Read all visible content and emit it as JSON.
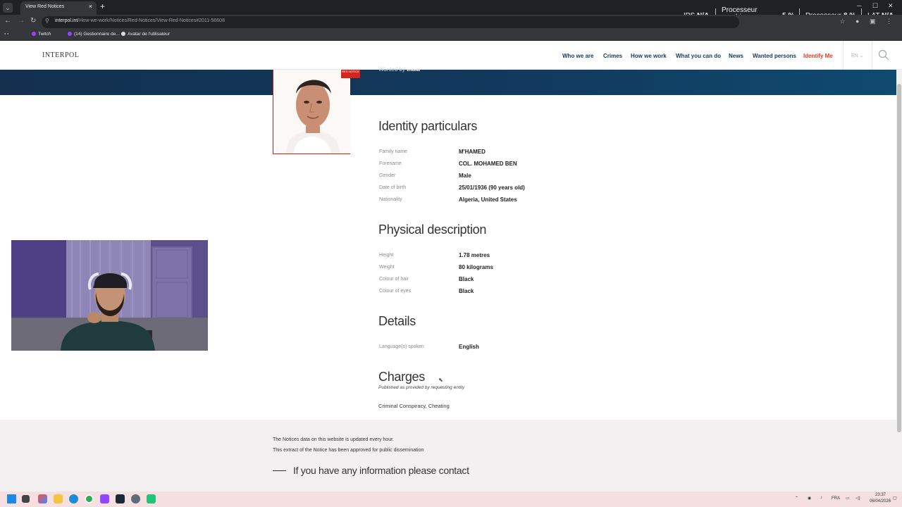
{
  "browser": {
    "tab_title": "View Red Notices",
    "tab_close": "×",
    "new_tab": "+",
    "tab_menu": "⌄",
    "url_domain": "interpol.int",
    "url_path": "/How-we-work/Notices/Red-Notices/View-Red-Notices#2011-56608",
    "bookmarks": [
      "Twitch",
      "(14) Gestionnaire de...",
      "Avatar de l'utilisateur"
    ]
  },
  "perf_overlay": {
    "ips_label": "IPS",
    "ips_value": "N/A",
    "gpu_label_1": "Processeur",
    "gpu_label_2": "graphique",
    "gpu_value": "5 %",
    "cpu_label": "Processeur",
    "cpu_value": "8 %",
    "lat_label": "LAT",
    "lat_value": "N/A"
  },
  "site": {
    "logo": "INTERPOL",
    "nav": [
      "Who we are",
      "Crimes",
      "How we work",
      "What you can do",
      "News",
      "Wanted persons",
      "Identify Me"
    ],
    "language": "EN",
    "lang_chevron": "⌄"
  },
  "notice": {
    "tag": "RED NOTICE",
    "wanted_by_label": "Wanted by",
    "wanted_by_value": "India",
    "identity": {
      "title": "Identity particulars",
      "fields": [
        {
          "label": "Family name",
          "value": "M'HAMED"
        },
        {
          "label": "Forename",
          "value": "COL. MOHAMED BEN"
        },
        {
          "label": "Gender",
          "value": "Male"
        },
        {
          "label": "Date of birth",
          "value": "25/01/1936 (90 years old)"
        },
        {
          "label": "Nationality",
          "value": "Algeria, United States"
        }
      ]
    },
    "physical": {
      "title": "Physical description",
      "fields": [
        {
          "label": "Height",
          "value": "1.78 metres"
        },
        {
          "label": "Weight",
          "value": "80 kilograms"
        },
        {
          "label": "Colour of hair",
          "value": "Black"
        },
        {
          "label": "Colour of eyes",
          "value": "Black"
        }
      ]
    },
    "details": {
      "title": "Details",
      "fields": [
        {
          "label": "Language(s) spoken",
          "value": "English"
        }
      ]
    },
    "charges": {
      "title": "Charges",
      "subtitle": "Published as provided by requesting entity",
      "text": "Criminal Conspiracy, Cheating"
    }
  },
  "footer": {
    "note1": "The Notices data on this website is updated every hour.",
    "note2": "This extract of the Notice has been approved for public dissemination",
    "cta": "If you have any information please contact"
  },
  "taskbar": {
    "lang": "FRA",
    "time": "23:37",
    "date": "06/04/2026"
  }
}
